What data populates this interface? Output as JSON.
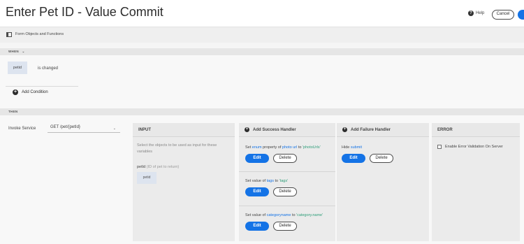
{
  "header": {
    "title": "Enter Pet ID - Value Commit",
    "help_label": "Help",
    "cancel_label": "Cancel"
  },
  "subbar": {
    "label": "Form Objects and Functions"
  },
  "when": {
    "section_label": "WHEN",
    "object": "petid",
    "condition": "is changed",
    "add_condition_label": "Add Condition"
  },
  "then": {
    "section_label": "THEN",
    "invoke_label": "Invoke Service",
    "service": "GET /pet/{petId}"
  },
  "input_card": {
    "heading": "INPUT",
    "description": "Select the objects to be used as input for these variables",
    "param_name": "petId",
    "param_desc": "(ID of pet to return)",
    "chip": "petid"
  },
  "success_card": {
    "heading": "Add Success Handler",
    "handlers": [
      {
        "pre": "Set ",
        "a": "enum",
        "mid1": " property of ",
        "b": "photo url",
        "mid2": " to ",
        "c": "'photoUrls'"
      },
      {
        "pre": "Set value of ",
        "b": "tags",
        "mid2": " to ",
        "c": "'tags'"
      },
      {
        "pre": "Set value of ",
        "b": "categoryname",
        "mid2": " to ",
        "c": "'category.name'"
      }
    ],
    "edit_label": "Edit",
    "delete_label": "Delete"
  },
  "failure_card": {
    "heading": "Add Failure Handler",
    "pre": "Hide ",
    "target": "submit",
    "edit_label": "Edit",
    "delete_label": "Delete"
  },
  "error_card": {
    "heading": "ERROR",
    "checkbox_label": "Enable Error Validation On Server"
  },
  "colors": {
    "accent": "#1473e6",
    "value_green": "#2d9d78"
  }
}
